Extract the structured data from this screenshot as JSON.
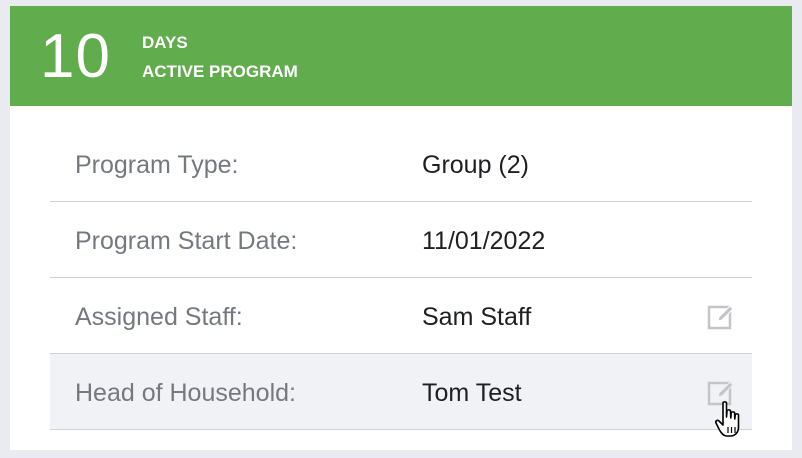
{
  "header": {
    "days_count": "10",
    "days_label": "DAYS",
    "status_label": "ACTIVE PROGRAM",
    "color": "#61ac4d"
  },
  "details": [
    {
      "label": "Program Type:",
      "value": "Group (2)",
      "editable": false
    },
    {
      "label": "Program Start Date:",
      "value": "11/01/2022",
      "editable": false
    },
    {
      "label": "Assigned Staff:",
      "value": "Sam Staff",
      "editable": true,
      "icon": "edit-icon"
    },
    {
      "label": "Head of Household:",
      "value": "Tom Test",
      "editable": true,
      "icon": "edit-icon",
      "hovered": true
    }
  ],
  "cursor": {
    "icon": "hand-pointer-icon"
  }
}
